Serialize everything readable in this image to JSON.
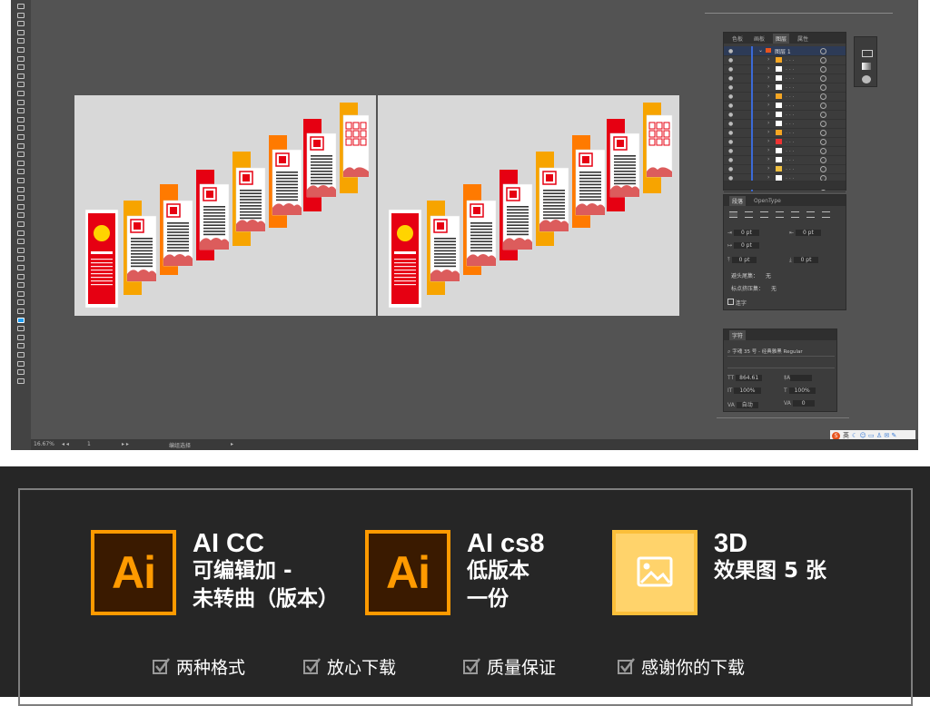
{
  "status": {
    "zoom": "16.67%",
    "page": "1",
    "mode": "编组选择"
  },
  "panels": {
    "layers": {
      "tabs": [
        "色板",
        "画板",
        "图层",
        "属性"
      ],
      "active_tab": "图层",
      "layer_name": "图层 1"
    },
    "paragraph": {
      "tabs": [
        "段落",
        "OpenType"
      ],
      "left_indent": "0 pt",
      "right_indent": "0 pt",
      "first_line_indent": "0 pt",
      "space_before": "0 pt",
      "space_after": "0 pt",
      "hyphen_rule_label": "避头尾集：",
      "hyphen_rule_value": "无",
      "punct_label": "标点挤压集：",
      "punct_value": "无",
      "hyphenate_label": "连字"
    },
    "character": {
      "tab": "字符",
      "font": "字魂 35 号 - 经典雅黑 Regular",
      "size": "864.61",
      "leading": "",
      "vscale": "100%",
      "hscale": "100%",
      "kerning": "自动",
      "tracking": "0"
    }
  },
  "ime": {
    "label": "英"
  },
  "features": [
    {
      "icon": "Ai",
      "title": "AI CC",
      "lines": [
        "可编辑加 -",
        "未转曲（版本）"
      ]
    },
    {
      "icon": "Ai",
      "title": "AI cs8",
      "lines": [
        "低版本",
        "一份"
      ]
    },
    {
      "icon": "image-icon",
      "title": "3D",
      "lines": [
        "效果图 5 张"
      ]
    }
  ],
  "checks": [
    "两种格式",
    "放心下载",
    "质量保证",
    "感谢你的下载"
  ],
  "colors": {
    "ai_orange": "#ff9a00",
    "ai_bg": "#3a1a00",
    "img_yellow": "#ffd36b",
    "red": "#e60012",
    "orange": "#ff7a00",
    "yellow": "#f7a400"
  }
}
